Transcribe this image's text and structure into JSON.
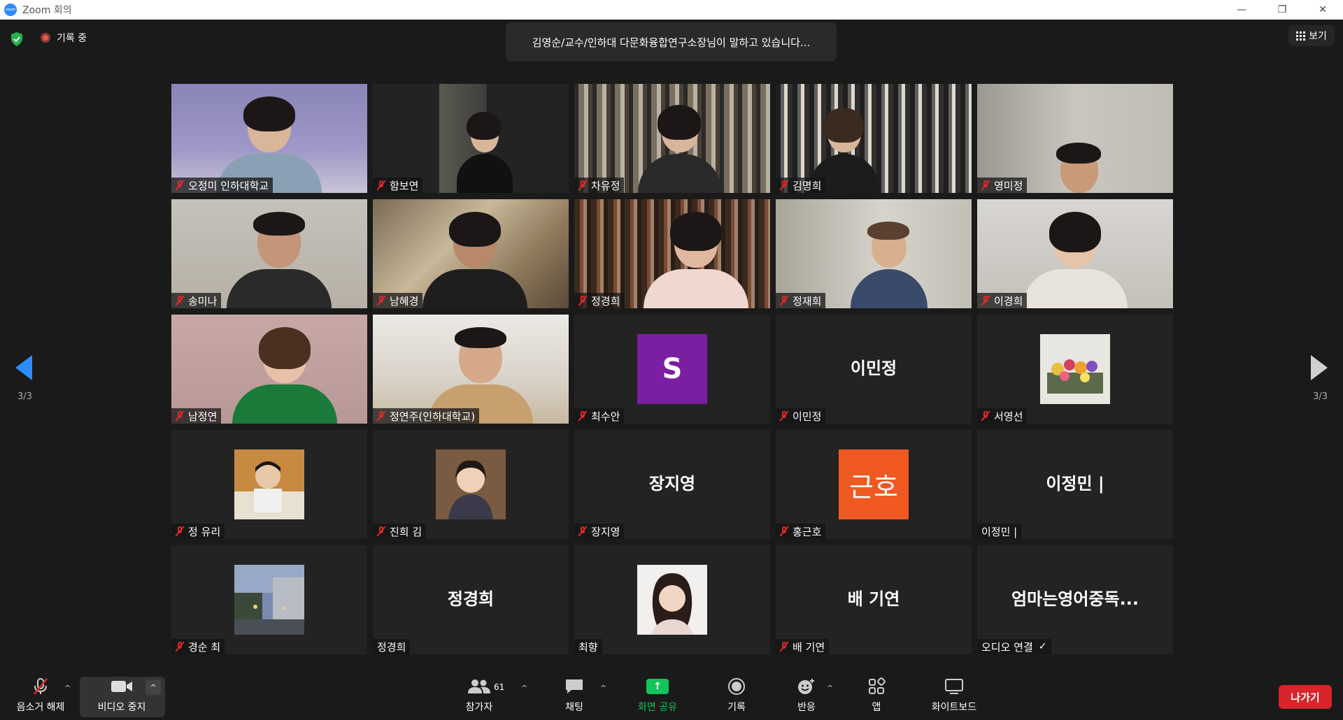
{
  "window": {
    "title": "Zoom 회의",
    "logo_text": "zoom"
  },
  "topbar": {
    "recording_label": "기록 중",
    "speaker_banner": "김영순/교수/인하대 다문화융합연구소장님이 말하고 있습니다...",
    "view_label": "보기"
  },
  "pagination": {
    "left": "3/3",
    "right": "3/3"
  },
  "tiles": [
    {
      "name": "오정미 인하대학교",
      "muted": true
    },
    {
      "name": "함보연",
      "muted": true
    },
    {
      "name": "차유정",
      "muted": true
    },
    {
      "name": "김명희",
      "muted": true
    },
    {
      "name": "영미정",
      "muted": true
    },
    {
      "name": "송미나",
      "muted": true
    },
    {
      "name": "남혜경",
      "muted": true
    },
    {
      "name": "정경희",
      "muted": true
    },
    {
      "name": "정재희",
      "muted": true
    },
    {
      "name": "이경희",
      "muted": true
    },
    {
      "name": "남정연",
      "muted": true
    },
    {
      "name": "정연주(인하대학교)",
      "muted": true
    },
    {
      "name": "최수안",
      "muted": true,
      "avatar_letter": "S"
    },
    {
      "name": "이민정",
      "muted": true,
      "display_name": "이민정"
    },
    {
      "name": "서영선",
      "muted": true
    },
    {
      "name": "정 유리",
      "muted": true
    },
    {
      "name": "진희 김",
      "muted": true
    },
    {
      "name": "장지영",
      "muted": true,
      "display_name": "장지영"
    },
    {
      "name": "홍근호",
      "muted": true,
      "avatar_text": "근호"
    },
    {
      "name": "이정민 |",
      "muted": false,
      "display_name": "이정민 |"
    },
    {
      "name": "경순 최",
      "muted": true
    },
    {
      "name": "정경희",
      "muted": false,
      "display_name": "정경희"
    },
    {
      "name": "최향",
      "muted": false
    },
    {
      "name": "배 기연",
      "muted": true,
      "display_name": "배 기연"
    },
    {
      "name": "오디오 연결",
      "muted": false,
      "display_name": "엄마는영어중독...",
      "check": "✓"
    }
  ],
  "toolbar": {
    "unmute_label": "음소거 해제",
    "video_label": "비디오 중지",
    "participants_label": "참가자",
    "participants_count": "61",
    "chat_label": "채팅",
    "share_label": "화면 공유",
    "record_label": "기록",
    "reactions_label": "반응",
    "apps_label": "앱",
    "whiteboard_label": "화이트보드",
    "leave_label": "나가기"
  },
  "colors": {
    "accent": "#2d8cff",
    "share_green": "#13c45a",
    "leave_red": "#d8242a",
    "mute_red": "#e02828"
  }
}
